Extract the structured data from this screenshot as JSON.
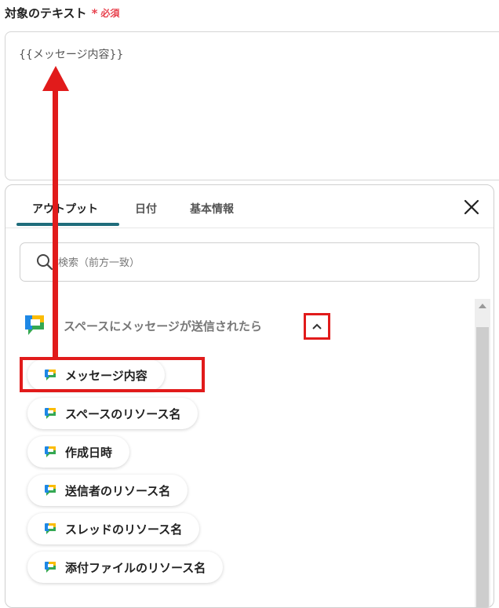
{
  "field": {
    "label": "対象のテキスト",
    "required_star": "*",
    "required_text": "必須",
    "value": "{{メッセージ内容}}"
  },
  "tabs": [
    {
      "label": "アウトプット",
      "active": true
    },
    {
      "label": "日付",
      "active": false
    },
    {
      "label": "基本情報",
      "active": false
    }
  ],
  "search": {
    "placeholder": "検索（前方一致）"
  },
  "group": {
    "title": "スペースにメッセージが送信されたら",
    "items": [
      "メッセージ内容",
      "スペースのリソース名",
      "作成日時",
      "送信者のリソース名",
      "スレッドのリソース名",
      "添付ファイルのリソース名"
    ]
  },
  "colors": {
    "accent": "#1f6c7b",
    "required": "#e8434f",
    "annotation": "#e11b1b"
  },
  "icons": {
    "close": "close-icon",
    "search": "search-icon",
    "collapse": "chevron-up-icon",
    "app": "google-chat-icon"
  }
}
